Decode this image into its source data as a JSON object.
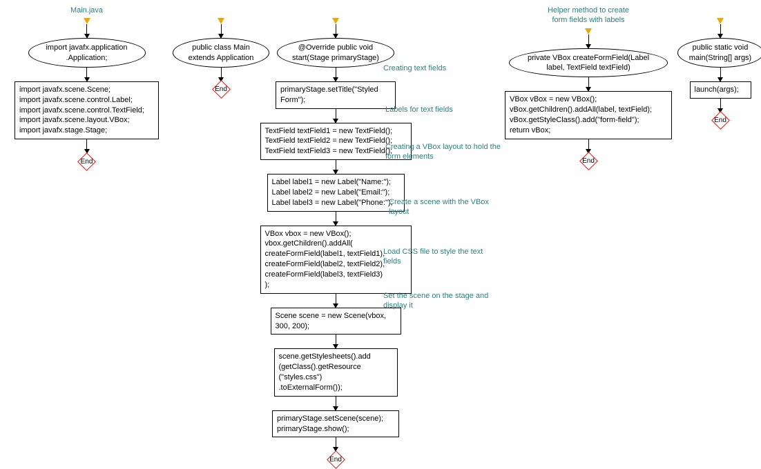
{
  "col1": {
    "title": "Main.java",
    "ellipse": "import javafx.application\n.Application;",
    "box": "import javafx.scene.Scene;\nimport javafx.scene.control.Label;\nimport javafx.scene.control.TextField;\nimport javafx.scene.layout.VBox;\nimport javafx.stage.Stage;",
    "end": "End"
  },
  "col2": {
    "ellipse": "public class Main\nextends Application",
    "end": "End"
  },
  "col3": {
    "ellipse": "@Override public void\nstart(Stage primaryStage)",
    "b1": "primaryStage.setTitle(\"Styled\nForm\");",
    "b2": "TextField textField1 = new TextField();\nTextField textField2 = new TextField();\nTextField textField3 = new TextField();",
    "b3": "Label label1 = new Label(\"Name:\");\nLabel label2 = new Label(\"Email:\");\nLabel label3 = new Label(\"Phone:\");",
    "b4": "VBox vbox = new VBox();\nvbox.getChildren().addAll(\n createFormField(label1, textField1),\n createFormField(label2, textField2),\n createFormField(label3, textField3)\n);",
    "b5": "Scene scene = new Scene(vbox,\n300, 200);",
    "b6": "scene.getStylesheets().add\n(getClass().getResource\n(\"styles.css\")\n.toExternalForm());",
    "b7": "primaryStage.setScene(scene);\nprimaryStage.show();",
    "end": "End"
  },
  "col4": {
    "title": "Helper method to create\nform fields with labels",
    "ellipse": "private VBox createFormField(Label\nlabel, TextField\ntextField)",
    "box": "VBox vBox = new VBox();\nvBox.getChildren().addAll(label, textField);\nvBox.getStyleClass().add(\"form-field\");\nreturn vBox;",
    "end": "End"
  },
  "col5": {
    "ellipse": "public static void\nmain(String[] args)",
    "box": "launch(args);",
    "end": "End"
  },
  "annotations": {
    "a1": "Creating text fields",
    "a2": "Labels for text fields",
    "a3": "Creating a VBox layout to\nhold the form elements",
    "a4": "Create a scene with\nthe VBox layout",
    "a5": "Load CSS file to style the\ntext fields",
    "a6": "Set the scene on the stage\nand display it"
  }
}
